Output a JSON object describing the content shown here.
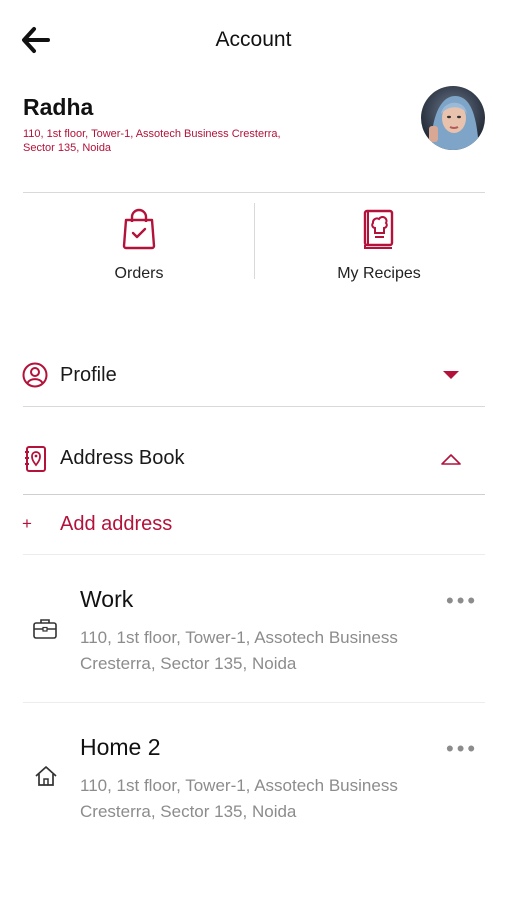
{
  "header": {
    "title": "Account"
  },
  "user": {
    "name": "Radha",
    "address": "110, 1st floor, Tower-1, Assotech Business Cresterra, Sector 135, Noida"
  },
  "tiles": [
    {
      "label": "Orders",
      "icon": "shopping-bag-icon"
    },
    {
      "label": "My Recipes",
      "icon": "recipe-book-icon"
    }
  ],
  "sections": {
    "profile": {
      "label": "Profile"
    },
    "address_book": {
      "label": "Address Book"
    },
    "add_address": {
      "prefix": "+",
      "label": "Add address"
    }
  },
  "addresses": [
    {
      "title": "Work",
      "address": "110, 1st floor, Tower-1, Assotech Business Cresterra, Sector 135, Noida",
      "icon": "briefcase-icon",
      "menu": "•••"
    },
    {
      "title": "Home 2",
      "address": "110, 1st floor, Tower-1, Assotech Business Cresterra, Sector 135, Noida",
      "icon": "home-icon",
      "menu": "•••"
    }
  ],
  "colors": {
    "accent": "#b3123a",
    "divider": "#d9d9d9",
    "muted": "#8c8c8c"
  }
}
